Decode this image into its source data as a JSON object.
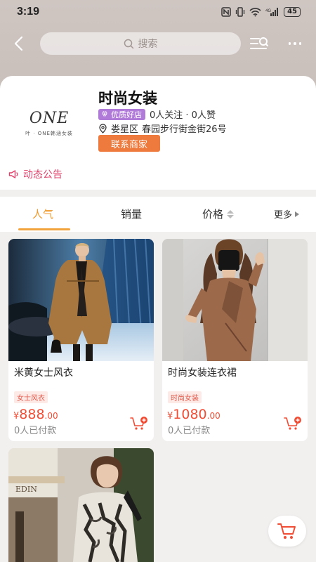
{
  "status_bar": {
    "time": "3:19",
    "battery": "45"
  },
  "nav": {
    "search_placeholder": "搜索",
    "icons": [
      "back-icon",
      "search-icon",
      "list-search-icon",
      "more-icon"
    ]
  },
  "shop": {
    "logo_text": "ONE",
    "logo_subtext": "叶 · ONE韩涵女装",
    "name": "时尚女装",
    "badge": "优质好店",
    "stats": "0人关注 · 0人赞",
    "district": "娄星区",
    "address": "春园步行街金街26号",
    "contact_label": "联系商家",
    "announcement": "动态公告"
  },
  "sort_tabs": {
    "popular": "人气",
    "sales": "销量",
    "price": "价格",
    "more": "更多"
  },
  "products": [
    {
      "title": "米黄女士风衣",
      "tag": "女士风衣",
      "price_symbol": "¥",
      "price_int": "888",
      "price_dec": ".00",
      "sold": "0人已付款"
    },
    {
      "title": "时尚女装连衣裙",
      "tag": "时尚女装",
      "price_symbol": "¥",
      "price_int": "1080",
      "price_dec": ".00",
      "sold": "0人已付款"
    },
    {
      "title": "",
      "tag": "",
      "price_symbol": "",
      "price_int": "",
      "price_dec": "",
      "sold": ""
    }
  ],
  "colors": {
    "accent_orange": "#f09a2e",
    "price_red": "#f14d35",
    "contact_button": "#ee7a3d",
    "badge_purple": "#b07ad8",
    "announcement_pink": "#e0416a"
  }
}
